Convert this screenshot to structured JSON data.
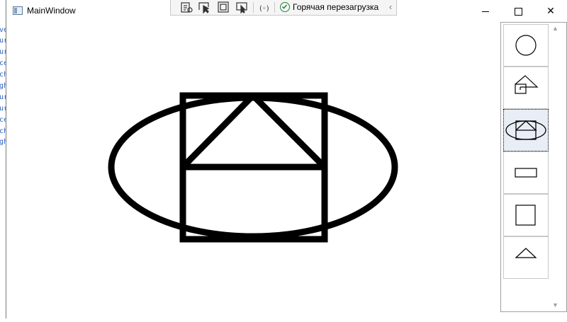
{
  "background_editor": {
    "fragments": [
      "ve",
      "ur",
      "ur",
      "ce",
      "ch",
      "gh",
      "ur",
      "ur",
      "ce",
      "ch",
      "gh"
    ]
  },
  "window": {
    "title": "MainWindow",
    "icon": "app-window-icon",
    "controls": {
      "minimize": "minimize-icon",
      "maximize": "maximize-icon",
      "close": "✕"
    }
  },
  "debug_toolbar": {
    "tools": [
      "live-visual-tree-icon",
      "select-element-icon",
      "display-adorners-icon",
      "track-focus-icon",
      "binding-failures-icon"
    ],
    "hot_reload_label": "Горячая перезагрузка",
    "hot_reload_status_color": "#1b8a3a",
    "collapse_glyph": "‹"
  },
  "shape_panel": {
    "buttons": [
      {
        "shape": "circle",
        "selected": false
      },
      {
        "shape": "house-composite",
        "selected": false
      },
      {
        "shape": "ellipse-house-composite",
        "selected": true
      },
      {
        "shape": "rectangle",
        "selected": false
      },
      {
        "shape": "square",
        "selected": false
      },
      {
        "shape": "triangle",
        "selected": false
      }
    ]
  },
  "canvas": {
    "drawn_shape": "ellipse-house-composite",
    "stroke_color": "#000000"
  }
}
